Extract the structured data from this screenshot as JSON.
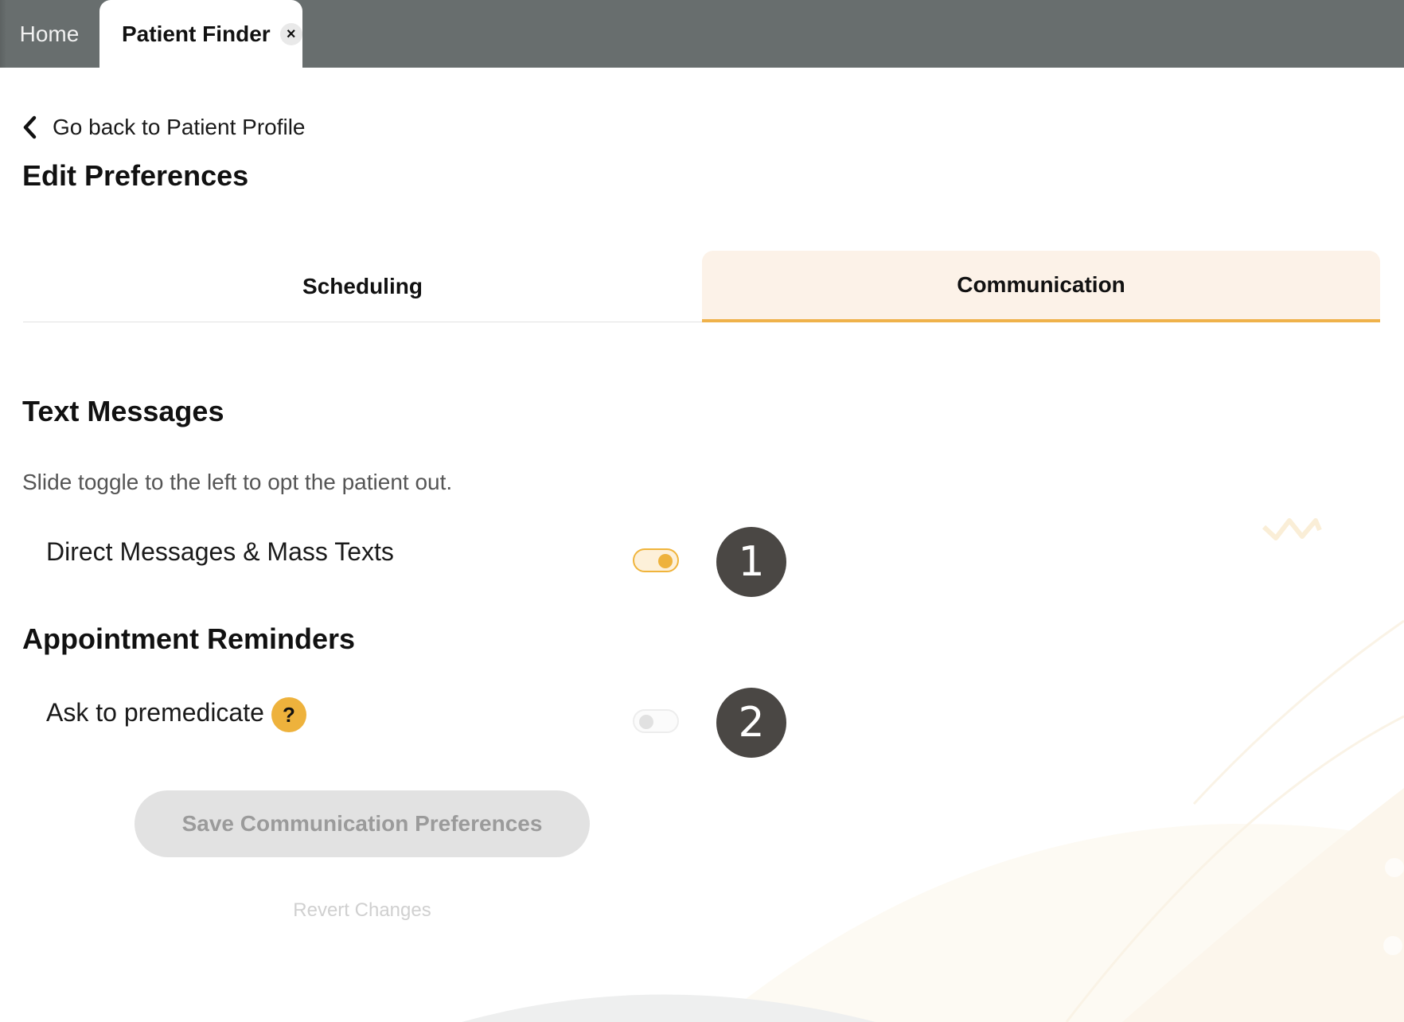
{
  "tabs": {
    "home": "Home",
    "active": "Patient Finder",
    "close_glyph": "×"
  },
  "nav": {
    "back_label": "Go back to Patient Profile"
  },
  "page": {
    "title": "Edit Preferences"
  },
  "pref_tabs": {
    "scheduling": "Scheduling",
    "communication": "Communication",
    "selected": "Communication"
  },
  "text_messages": {
    "title": "Text Messages",
    "helper": "Slide toggle to the left to opt the patient out.",
    "direct_label": "Direct Messages & Mass Texts",
    "direct_enabled": true,
    "badge": "1"
  },
  "appointment_reminders": {
    "title": "Appointment Reminders",
    "premedicate_label": "Ask to premedicate",
    "premedicate_enabled": false,
    "help_glyph": "?",
    "badge": "2"
  },
  "actions": {
    "save_label": "Save Communication Preferences",
    "revert_label": "Revert Changes"
  },
  "colors": {
    "tab_strip": "#686e6e",
    "accent": "#efb24b",
    "active_tab_bg": "#fcf2e8",
    "badge_bg": "#4a4744",
    "disabled_button_bg": "#e2e2e2"
  },
  "icons": {
    "back": "chevron-left-icon",
    "close": "close-icon",
    "help": "question-mark-icon"
  }
}
